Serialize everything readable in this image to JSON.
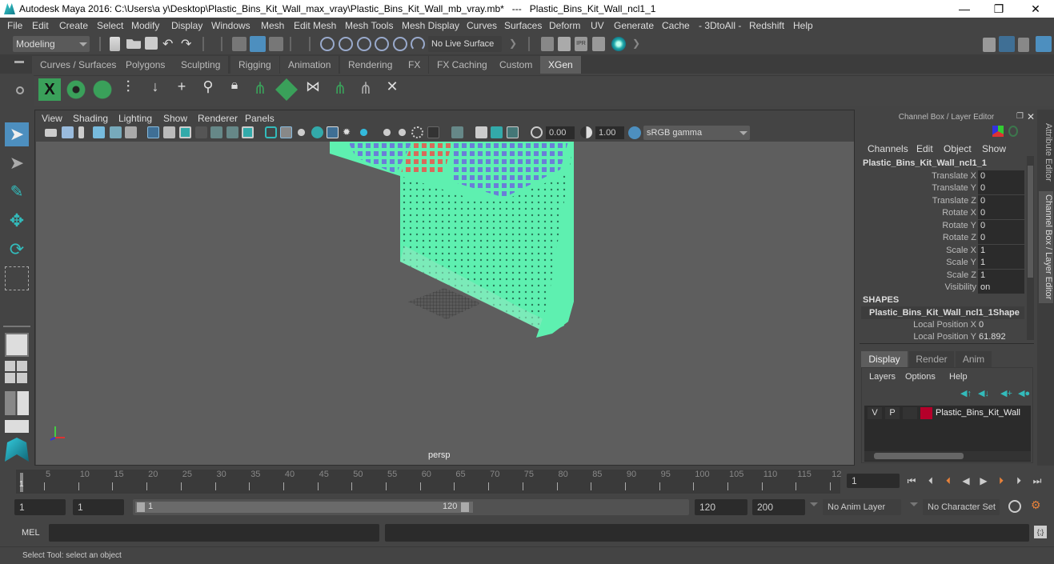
{
  "window": {
    "title": "Autodesk Maya 2016: C:\\Users\\a y\\Desktop\\Plastic_Bins_Kit_Wall_max_vray\\Plastic_Bins_Kit_Wall_mb_vray.mb*   ---   Plastic_Bins_Kit_Wall_ncl1_1",
    "minimize": "—",
    "restore": "❐",
    "close": "✕"
  },
  "menubar": [
    "File",
    "Edit",
    "Create",
    "Select",
    "Modify",
    "Display",
    "Windows",
    "Mesh",
    "Edit Mesh",
    "Mesh Tools",
    "Mesh Display",
    "Curves",
    "Surfaces",
    "Deform",
    "UV",
    "Generate",
    "Cache",
    "- 3DtoAll -",
    "Redshift",
    "Help"
  ],
  "statusline": {
    "mode": "Modeling",
    "live_surface": "No Live Surface"
  },
  "shelf_tabs": [
    "Curves / Surfaces",
    "Polygons",
    "Sculpting",
    "Rigging",
    "Animation",
    "Rendering",
    "FX",
    "FX Caching",
    "Custom",
    "XGen"
  ],
  "active_shelf_tab": "XGen",
  "viewport": {
    "menu": [
      "View",
      "Shading",
      "Lighting",
      "Show",
      "Renderer",
      "Panels"
    ],
    "exposure": "0.00",
    "gamma": "1.00",
    "color_space": "sRGB gamma",
    "camera_label": "persp"
  },
  "channel_box": {
    "title": "Channel Box / Layer Editor",
    "menu": [
      "Channels",
      "Edit",
      "Object",
      "Show"
    ],
    "object_name": "Plastic_Bins_Kit_Wall_ncl1_1",
    "channels": [
      {
        "label": "Translate X",
        "value": "0"
      },
      {
        "label": "Translate Y",
        "value": "0"
      },
      {
        "label": "Translate Z",
        "value": "0"
      },
      {
        "label": "Rotate X",
        "value": "0"
      },
      {
        "label": "Rotate Y",
        "value": "0"
      },
      {
        "label": "Rotate Z",
        "value": "0"
      },
      {
        "label": "Scale X",
        "value": "1"
      },
      {
        "label": "Scale Y",
        "value": "1"
      },
      {
        "label": "Scale Z",
        "value": "1"
      },
      {
        "label": "Visibility",
        "value": "on"
      }
    ],
    "shapes_header": "SHAPES",
    "shape_name": "Plastic_Bins_Kit_Wall_ncl1_1Shape",
    "shape_channels": [
      {
        "label": "Local Position X",
        "value": "0"
      },
      {
        "label": "Local Position Y",
        "value": "61.892"
      }
    ]
  },
  "layer_editor": {
    "tabs": [
      "Display",
      "Render",
      "Anim"
    ],
    "active_tab": "Display",
    "menu": [
      "Layers",
      "Options",
      "Help"
    ],
    "layers": [
      {
        "v": "V",
        "p": "P",
        "name": "Plastic_Bins_Kit_Wall",
        "color": "#b5002a"
      }
    ]
  },
  "side_tabs": [
    "Attribute Editor",
    "Channel Box / Layer Editor"
  ],
  "timeline": {
    "ticks": [
      "5",
      "10",
      "15",
      "20",
      "25",
      "30",
      "35",
      "40",
      "45",
      "50",
      "55",
      "60",
      "65",
      "70",
      "75",
      "80",
      "85",
      "90",
      "95",
      "100",
      "105",
      "110",
      "115",
      "12"
    ],
    "current_marker": "1",
    "current_frame": "1"
  },
  "range": {
    "start": "1",
    "playback_start": "1",
    "slider_start": "1",
    "slider_end": "120",
    "playback_end": "120",
    "end": "200",
    "anim_layer": "No Anim Layer",
    "character_set": "No Character Set"
  },
  "command_line": {
    "lang": "MEL"
  },
  "help_line": "Select Tool: select an object"
}
